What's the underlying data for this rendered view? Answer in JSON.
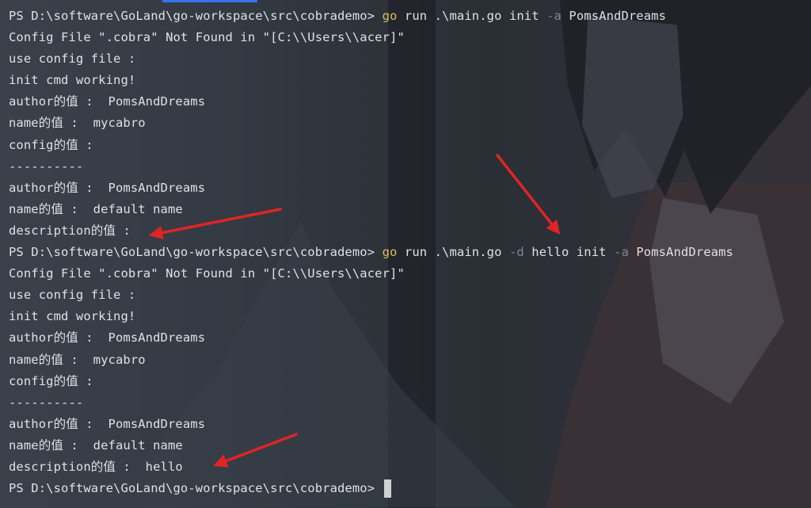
{
  "terminal": {
    "lines": [
      {
        "type": "cmd",
        "prompt": "PS D:\\software\\GoLand\\go-workspace\\src\\cobrademo> ",
        "cmd": "go",
        "args": " run .\\main.go init ",
        "flag1": "-a",
        "rest1": " PomsAndDreams",
        "flag2": "",
        "rest2": ""
      },
      {
        "type": "out",
        "text": "Config File \".cobra\" Not Found in \"[C:\\\\Users\\\\acer]\""
      },
      {
        "type": "out",
        "text": "use config file :"
      },
      {
        "type": "out",
        "text": "init cmd working!"
      },
      {
        "type": "out",
        "text": "author的值 :  PomsAndDreams"
      },
      {
        "type": "out",
        "text": "name的值 :  mycabro"
      },
      {
        "type": "out",
        "text": "config的值 :"
      },
      {
        "type": "out",
        "text": "----------"
      },
      {
        "type": "out",
        "text": "author的值 :  PomsAndDreams"
      },
      {
        "type": "out",
        "text": "name的值 :  default name"
      },
      {
        "type": "out",
        "text": "description的值 :"
      },
      {
        "type": "cmd",
        "prompt": "PS D:\\software\\GoLand\\go-workspace\\src\\cobrademo> ",
        "cmd": "go",
        "args": " run .\\main.go ",
        "flag1": "-d",
        "rest1": " hello init ",
        "flag2": "-a",
        "rest2": " PomsAndDreams"
      },
      {
        "type": "out",
        "text": "Config File \".cobra\" Not Found in \"[C:\\\\Users\\\\acer]\""
      },
      {
        "type": "out",
        "text": "use config file :"
      },
      {
        "type": "out",
        "text": "init cmd working!"
      },
      {
        "type": "out",
        "text": "author的值 :  PomsAndDreams"
      },
      {
        "type": "out",
        "text": "name的值 :  mycabro"
      },
      {
        "type": "out",
        "text": "config的值 :"
      },
      {
        "type": "out",
        "text": "----------"
      },
      {
        "type": "out",
        "text": "author的值 :  PomsAndDreams"
      },
      {
        "type": "out",
        "text": "name的值 :  default name"
      },
      {
        "type": "out",
        "text": "description的值 :  hello"
      },
      {
        "type": "prompt",
        "prompt": "PS D:\\software\\GoLand\\go-workspace\\src\\cobrademo> "
      }
    ]
  },
  "colors": {
    "command": "#d8c15c",
    "flag": "#7e868e",
    "text": "#dfe1e5",
    "annotation_arrow": "#e02424",
    "tab_indicator": "#3574f0"
  }
}
